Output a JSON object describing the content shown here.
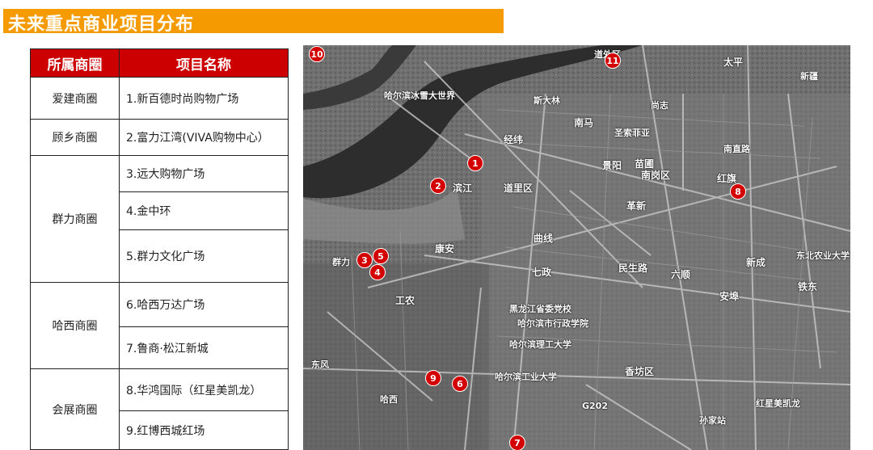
{
  "title": "未来重点商业项目分布",
  "table": {
    "headers": [
      "所属商圈",
      "项目名称"
    ],
    "groups": [
      {
        "area": "爱建商圈",
        "projects": [
          "1.新百德时尚购物广场"
        ]
      },
      {
        "area": "顾乡商圈",
        "projects": [
          "2.富力江湾(VIVA购物中心）"
        ]
      },
      {
        "area": "群力商圈",
        "projects": [
          "3.远大购物广场",
          "4.金中环",
          "5.群力文化广场"
        ]
      },
      {
        "area": "哈西商圈",
        "projects": [
          "6.哈西万达广场",
          "7.鲁商·松江新城"
        ]
      },
      {
        "area": "会展商圈",
        "projects": [
          "8.华鸿国际（红星美凯龙）",
          "9.红博西城红场"
        ]
      }
    ]
  },
  "map": {
    "labels": [
      "哈尔滨冰雪大世界",
      "斯大林",
      "尚志",
      "南马",
      "经纬",
      "道外区",
      "太平",
      "新疆",
      "圣索菲亚",
      "苗圃",
      "景阳",
      "南直路",
      "道里区",
      "南岗区",
      "红旗",
      "群力",
      "康安",
      "曲线",
      "革新",
      "七政",
      "民生路",
      "六顺",
      "新成",
      "铁东",
      "工农",
      "黑龙江省委党校",
      "哈尔滨市行政学院",
      "哈尔滨理工大学",
      "哈尔滨工业大学",
      "香坊区",
      "安埠",
      "哈西",
      "红星美凯龙",
      "孙家站",
      "东北农业大学",
      "东风",
      "G202",
      "滨江"
    ],
    "markers": [
      "1",
      "2",
      "3",
      "4",
      "5",
      "6",
      "7",
      "8",
      "9",
      "10",
      "11"
    ]
  },
  "colors": {
    "title_bar": "#f59a00",
    "header_bg": "#cc0000",
    "marker": "#d40000"
  }
}
